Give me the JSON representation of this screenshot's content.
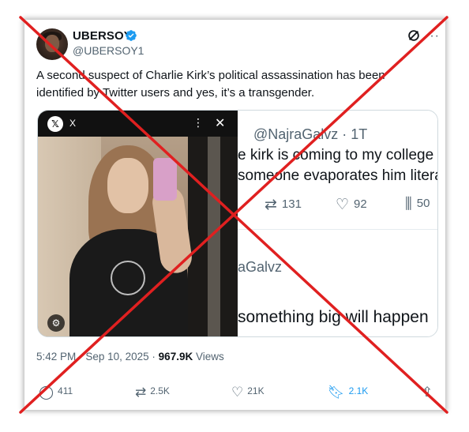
{
  "tweet": {
    "author_name": "UBERSOY",
    "author_handle": "@UBERSOY1",
    "text": "A second suspect of Charlie Kirk’s political assassination has been identified by Twitter users and yes, it’s a transgender.",
    "time": "5:42 PM",
    "separator": "·",
    "date": "Sep 10, 2025",
    "views_count": "967.9K",
    "views_label": "Views"
  },
  "media": {
    "photo_source_label": "X",
    "embedded_tweet": {
      "handle_line": "@NajraGalvz · 1T",
      "line1": "e kirk is coming to my college t",
      "line2": "someone evaporates him litera",
      "retweets": "131",
      "likes": "92",
      "views": "50",
      "handle_line_2": "aGalvz",
      "line3": "something big will happen"
    }
  },
  "actions": {
    "replies": "411",
    "retweets": "2.5K",
    "likes": "21K",
    "bookmarks": "2.1K"
  },
  "colors": {
    "accent": "#1d9bf0",
    "cross": "#e02020",
    "muted_text": "#536471"
  }
}
